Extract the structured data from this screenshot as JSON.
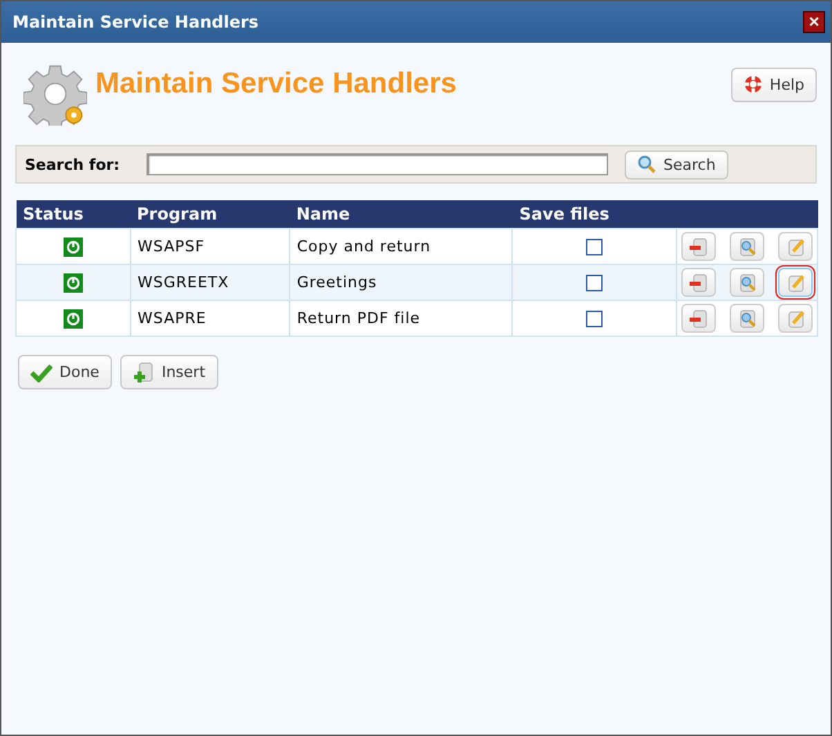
{
  "window": {
    "title": "Maintain Service Handlers",
    "close": "×"
  },
  "header": {
    "title": "Maintain Service Handlers",
    "help_button": "Help"
  },
  "search": {
    "label": "Search for:",
    "button": "Search"
  },
  "table": {
    "columns": [
      "Status",
      "Program",
      "Name",
      "Save files"
    ],
    "rows": [
      {
        "program": "WSAPSF",
        "name": "Copy and return",
        "active": true,
        "save_files": false,
        "selected": false,
        "edit_focused": false
      },
      {
        "program": "WSGREETX",
        "name": "Greetings",
        "active": true,
        "save_files": false,
        "selected": true,
        "edit_focused": true
      },
      {
        "program": "WSAPRE",
        "name": "Return PDF file",
        "active": true,
        "save_files": false,
        "selected": false,
        "edit_focused": false
      }
    ]
  },
  "buttons": [
    {
      "kind": "done",
      "label": "Done"
    },
    {
      "kind": "insert",
      "label": "Insert"
    }
  ]
}
